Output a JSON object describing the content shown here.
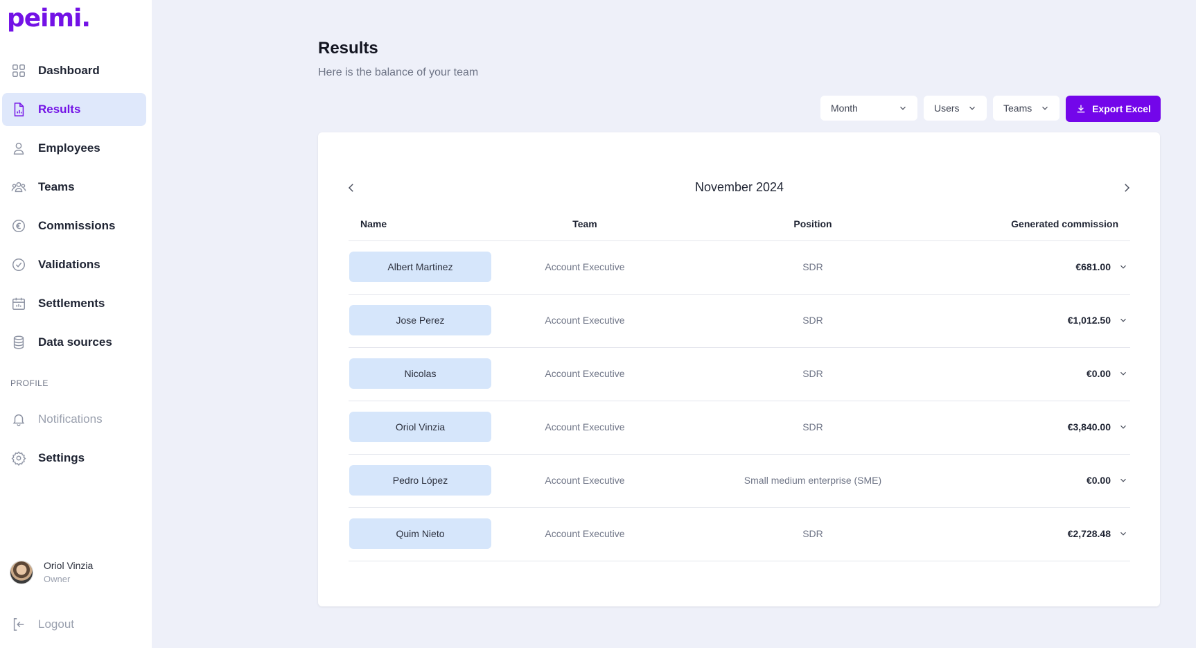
{
  "brand": {
    "logo": "peimi."
  },
  "sidebar": {
    "items": [
      {
        "label": "Dashboard",
        "icon": "grid-icon"
      },
      {
        "label": "Results",
        "icon": "report-icon",
        "active": true
      },
      {
        "label": "Employees",
        "icon": "user-icon"
      },
      {
        "label": "Teams",
        "icon": "team-icon"
      },
      {
        "label": "Commissions",
        "icon": "euro-icon"
      },
      {
        "label": "Validations",
        "icon": "check-circle-icon"
      },
      {
        "label": "Settlements",
        "icon": "calendar-icon"
      },
      {
        "label": "Data sources",
        "icon": "database-icon"
      }
    ],
    "profile_section": "PROFILE",
    "profile_items": [
      {
        "label": "Notifications",
        "icon": "bell-icon"
      },
      {
        "label": "Settings",
        "icon": "gear-icon"
      }
    ],
    "user": {
      "name": "Oriol Vinzia",
      "role": "Owner"
    },
    "logout": "Logout"
  },
  "header": {
    "title": "Results",
    "subtitle": "Here is the balance of your team"
  },
  "filters": {
    "month": "Month",
    "users": "Users",
    "teams": "Teams",
    "export": "Export Excel"
  },
  "table": {
    "period": "November 2024",
    "columns": [
      "Name",
      "Team",
      "Position",
      "Generated commission"
    ],
    "rows": [
      {
        "name": "Albert Martinez",
        "team": "Account Executive",
        "position": "SDR",
        "commission": "€681.00"
      },
      {
        "name": "Jose Perez",
        "team": "Account Executive",
        "position": "SDR",
        "commission": "€1,012.50"
      },
      {
        "name": "Nicolas",
        "team": "Account Executive",
        "position": "SDR",
        "commission": "€0.00"
      },
      {
        "name": "Oriol Vinzia",
        "team": "Account Executive",
        "position": "SDR",
        "commission": "€3,840.00"
      },
      {
        "name": "Pedro López",
        "team": "Account Executive",
        "position": "Small medium enterprise (SME)",
        "commission": "€0.00"
      },
      {
        "name": "Quim Nieto",
        "team": "Account Executive",
        "position": "SDR",
        "commission": "€2,728.48"
      }
    ]
  },
  "colors": {
    "brand": "#7312e6",
    "active_bg": "#dfe8fb",
    "pill_bg": "#d6e6fb",
    "page_bg": "#eef0f9"
  }
}
